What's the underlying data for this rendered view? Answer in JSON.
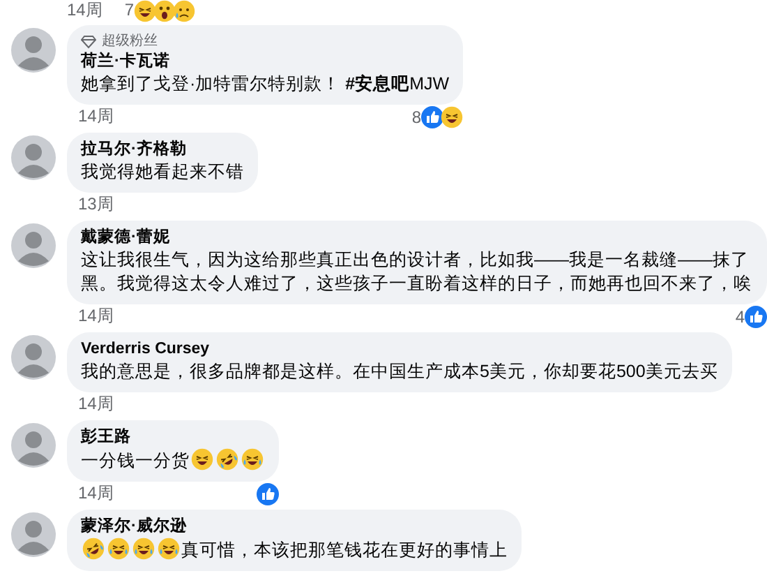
{
  "top_meta": {
    "time": "14周",
    "reaction_count": "7",
    "reactions": [
      {
        "kind": "haha"
      },
      {
        "kind": "wow"
      },
      {
        "kind": "sad"
      }
    ]
  },
  "comments": [
    {
      "badge": "超级粉丝",
      "author": "荷兰·卡瓦诺",
      "body": [
        {
          "kind": "text",
          "text": "她拿到了戈登·加特雷尔特别款！ **#安息吧**MJW"
        }
      ],
      "time": "14周",
      "reaction_count": "8",
      "reactions": [
        {
          "kind": "like"
        },
        {
          "kind": "haha"
        }
      ]
    },
    {
      "author": "拉马尔·齐格勒",
      "body": [
        {
          "kind": "text",
          "text": "我觉得她看起来不错"
        }
      ],
      "time": "13周"
    },
    {
      "author": "戴蒙德·蕾妮",
      "body": [
        {
          "kind": "text",
          "text": "这让我很生气，因为这给那些真正出色的设计者，比如我——我是一名裁缝——抹了黑。我觉得这太令人难过了，这些孩子一直盼着这样的日子，而她再也回不来了，唉"
        }
      ],
      "time": "14周",
      "reaction_count": "4",
      "reactions": [
        {
          "kind": "like"
        }
      ]
    },
    {
      "author": "Verderris Cursey",
      "body": [
        {
          "kind": "text",
          "text": "我的意思是，很多品牌都是这样。在中国生产成本5美元，你却要花500美元去买"
        }
      ],
      "time": "14周"
    },
    {
      "author": "彭王路",
      "body": [
        {
          "kind": "text",
          "text": "一分钱一分货"
        },
        {
          "kind": "squint"
        },
        {
          "kind": "rofl"
        },
        {
          "kind": "joy"
        }
      ],
      "time": "14周",
      "reactions": [
        {
          "kind": "like"
        }
      ]
    },
    {
      "author": "蒙泽尔·威尔逊",
      "body": [
        {
          "kind": "rofl"
        },
        {
          "kind": "joy"
        },
        {
          "kind": "joy"
        },
        {
          "kind": "joy"
        },
        {
          "kind": "text",
          "text": "真可惜，本该把那笔钱花在更好的事情上"
        }
      ]
    }
  ]
}
